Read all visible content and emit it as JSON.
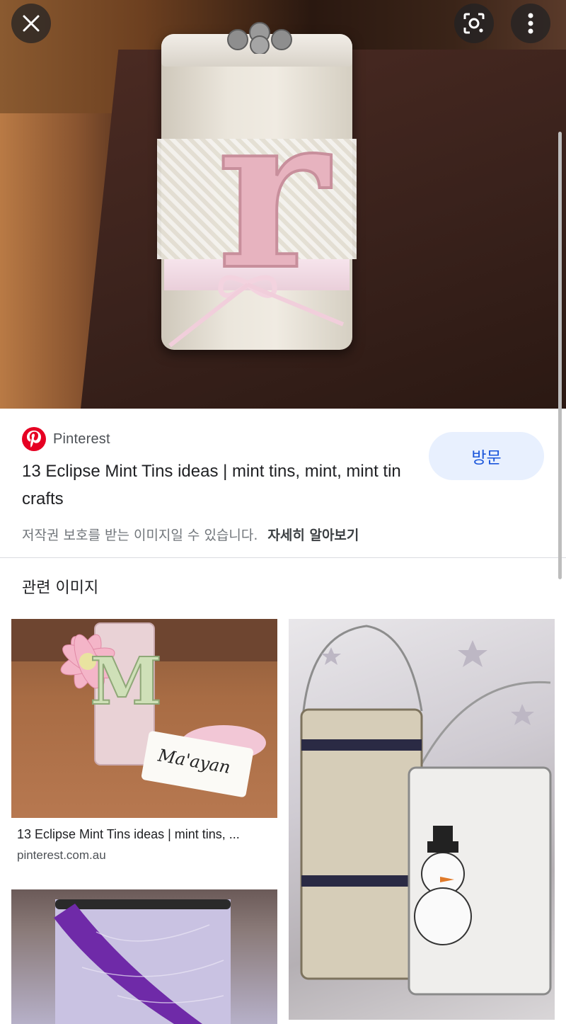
{
  "source": {
    "name": "Pinterest",
    "icon": "pinterest-logo"
  },
  "result": {
    "title": "13 Eclipse Mint Tins ideas | mint tins, mint, mint tin crafts",
    "visit_label": "방문",
    "copyright_notice": "저작권 보호를 받는 이미지일 수 있습니다.",
    "learn_more_label": "자세히 알아보기"
  },
  "controls": {
    "close_icon": "close-icon",
    "lens_icon": "lens-icon",
    "more_icon": "more-vert-icon"
  },
  "related": {
    "heading": "관련 이미지",
    "items": [
      {
        "title": "13 Eclipse Mint Tins ideas | mint tins, ...",
        "source": "pinterest.com.au",
        "tag_text": "Ma'ayan"
      }
    ]
  },
  "hero": {
    "letter": "r"
  },
  "colors": {
    "accent": "#1a56db",
    "visit_bg": "#e8f0fe",
    "pinterest_red": "#e60023"
  }
}
